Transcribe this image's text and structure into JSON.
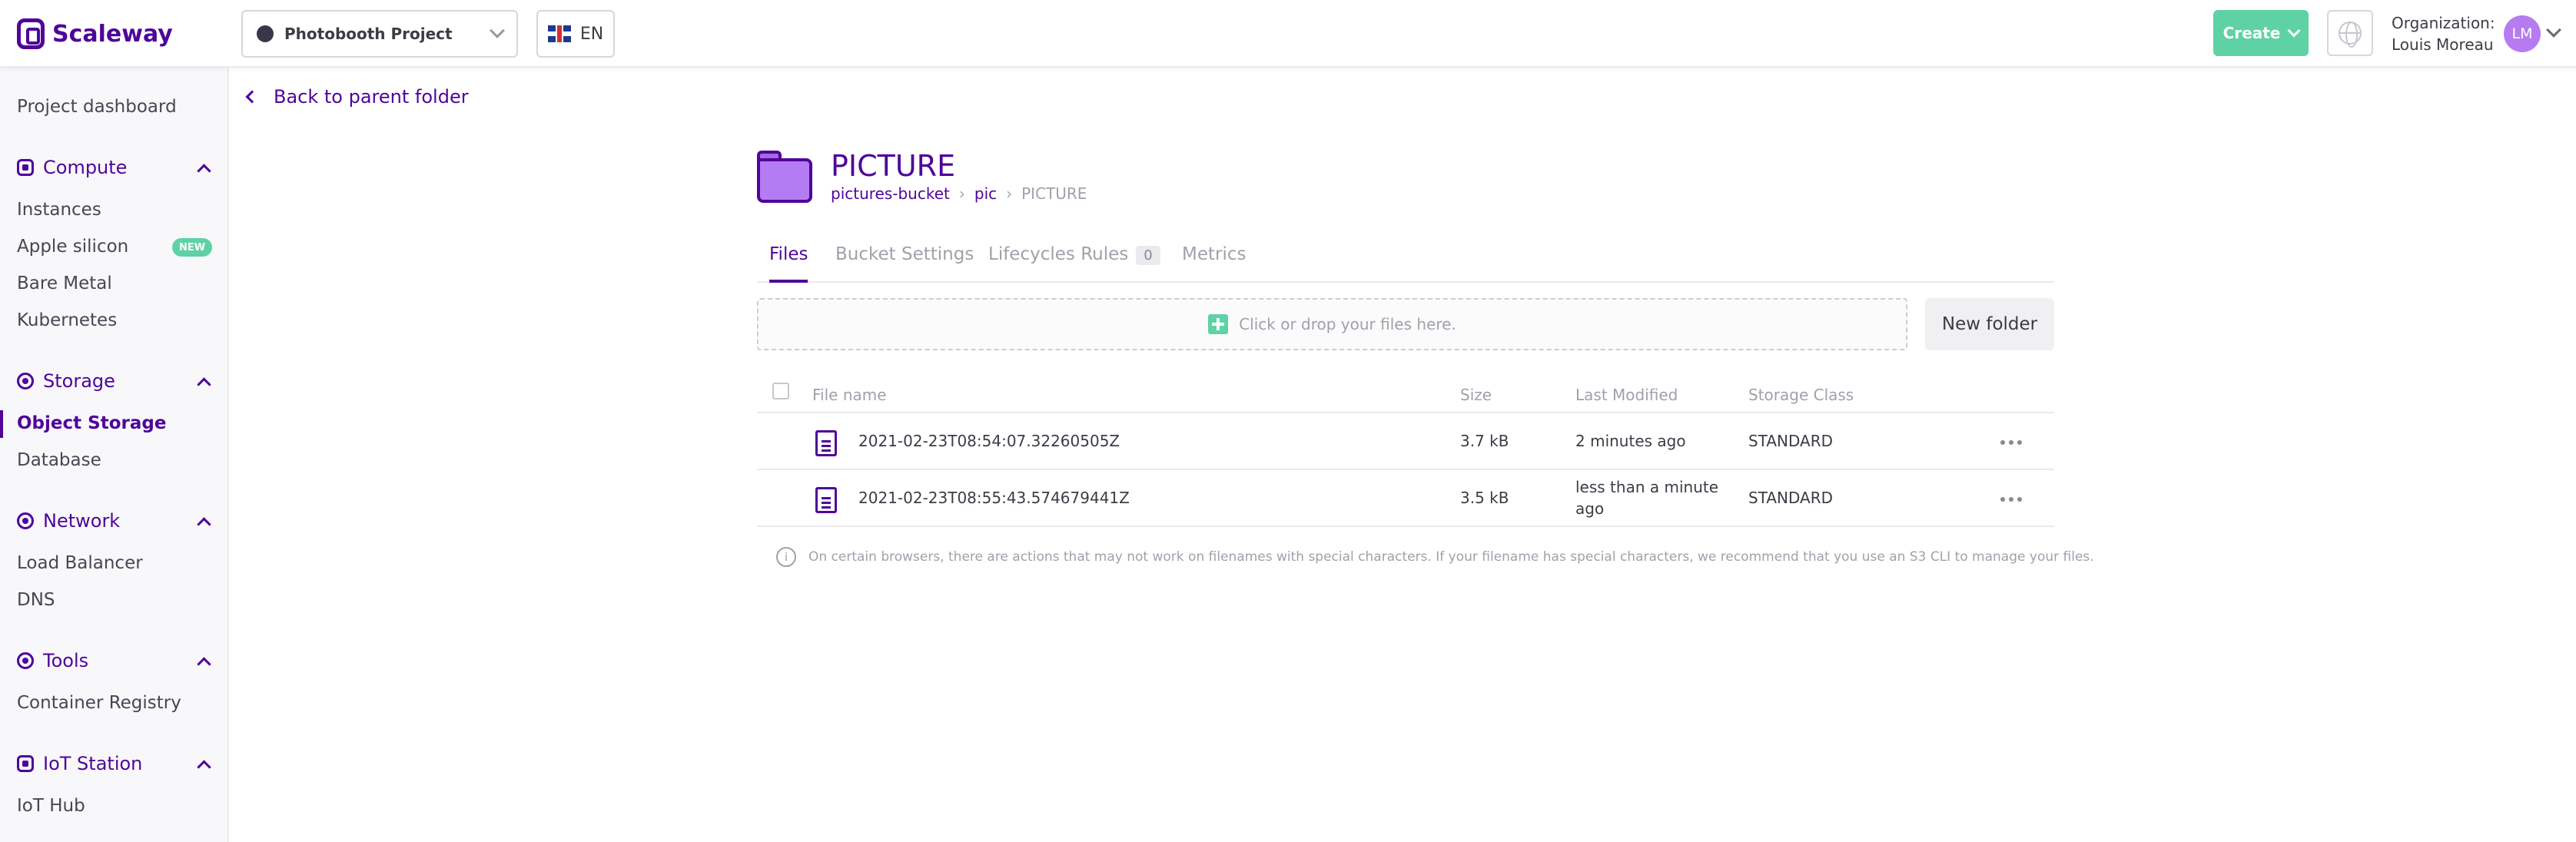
{
  "brand": {
    "name": "Scaleway"
  },
  "header": {
    "project": "Photobooth Project",
    "language": "EN",
    "create_label": "Create",
    "organization_label": "Organization:",
    "organization_user": "Louis Moreau",
    "avatar_initials": "LM"
  },
  "sidebar": {
    "dashboard": "Project dashboard",
    "groups": [
      {
        "label": "Compute",
        "items": [
          "Instances",
          "Apple silicon",
          "Bare Metal",
          "Kubernetes"
        ]
      },
      {
        "label": "Storage",
        "items": [
          "Object Storage",
          "Database"
        ]
      },
      {
        "label": "Network",
        "items": [
          "Load Balancer",
          "DNS"
        ]
      },
      {
        "label": "Tools",
        "items": [
          "Container Registry"
        ]
      },
      {
        "label": "IoT Station",
        "items": [
          "IoT Hub"
        ]
      }
    ],
    "new_badge": "NEW",
    "active_item": "Object Storage"
  },
  "main": {
    "back_label": "Back to parent folder",
    "folder_title": "PICTURE",
    "breadcrumb": [
      "pictures-bucket",
      "pic",
      "PICTURE"
    ],
    "breadcrumb_sep": "›",
    "tabs": [
      {
        "label": "Files"
      },
      {
        "label": "Bucket Settings"
      },
      {
        "label": "Lifecycles Rules",
        "count": "0"
      },
      {
        "label": "Metrics"
      }
    ],
    "dropzone_text": "Click or drop your files here.",
    "new_folder_label": "New folder",
    "table": {
      "headers": [
        "File name",
        "Size",
        "Last Modified",
        "Storage Class"
      ],
      "rows": [
        {
          "name": "2021-02-23T08:54:07.32260505Z",
          "size": "3.7 kB",
          "modified": "2 minutes ago",
          "class": "STANDARD"
        },
        {
          "name": "2021-02-23T08:55:43.574679441Z",
          "size": "3.5 kB",
          "modified_line1": "less than a minute",
          "modified_line2": "ago",
          "class": "STANDARD"
        }
      ]
    },
    "note": "On certain browsers, there are actions that may not work on filenames with special characters. If your filename has special characters, we recommend that you use an S3 CLI to manage your files."
  },
  "colors": {
    "brand": "#4f0599",
    "accent_green": "#5fd2a5",
    "avatar": "#b77bf0"
  }
}
